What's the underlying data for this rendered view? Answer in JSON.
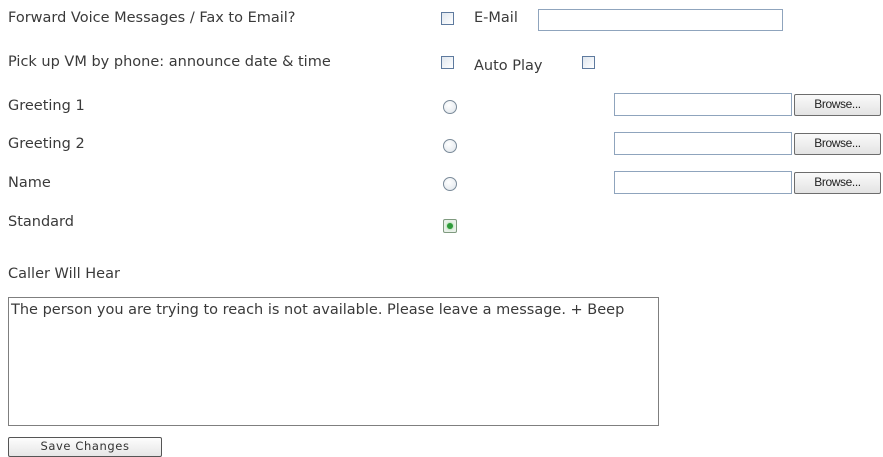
{
  "forward": {
    "label": "Forward Voice Messages / Fax to Email?",
    "email_label": "E-Mail",
    "email_value": ""
  },
  "pickup": {
    "label": "Pick up VM by phone: announce date & time",
    "autoplay_label": "Auto Play"
  },
  "greetings": [
    {
      "label": "Greeting 1",
      "browse_label": "Browse...",
      "file_value": ""
    },
    {
      "label": "Greeting 2",
      "browse_label": "Browse...",
      "file_value": ""
    },
    {
      "label": "Name",
      "browse_label": "Browse...",
      "file_value": ""
    },
    {
      "label": "Standard",
      "selected": true
    }
  ],
  "caller": {
    "label": "Caller Will Hear",
    "message": "The person you are trying to reach is not available. Please leave a message. + Beep"
  },
  "save_label": "Save Changes"
}
